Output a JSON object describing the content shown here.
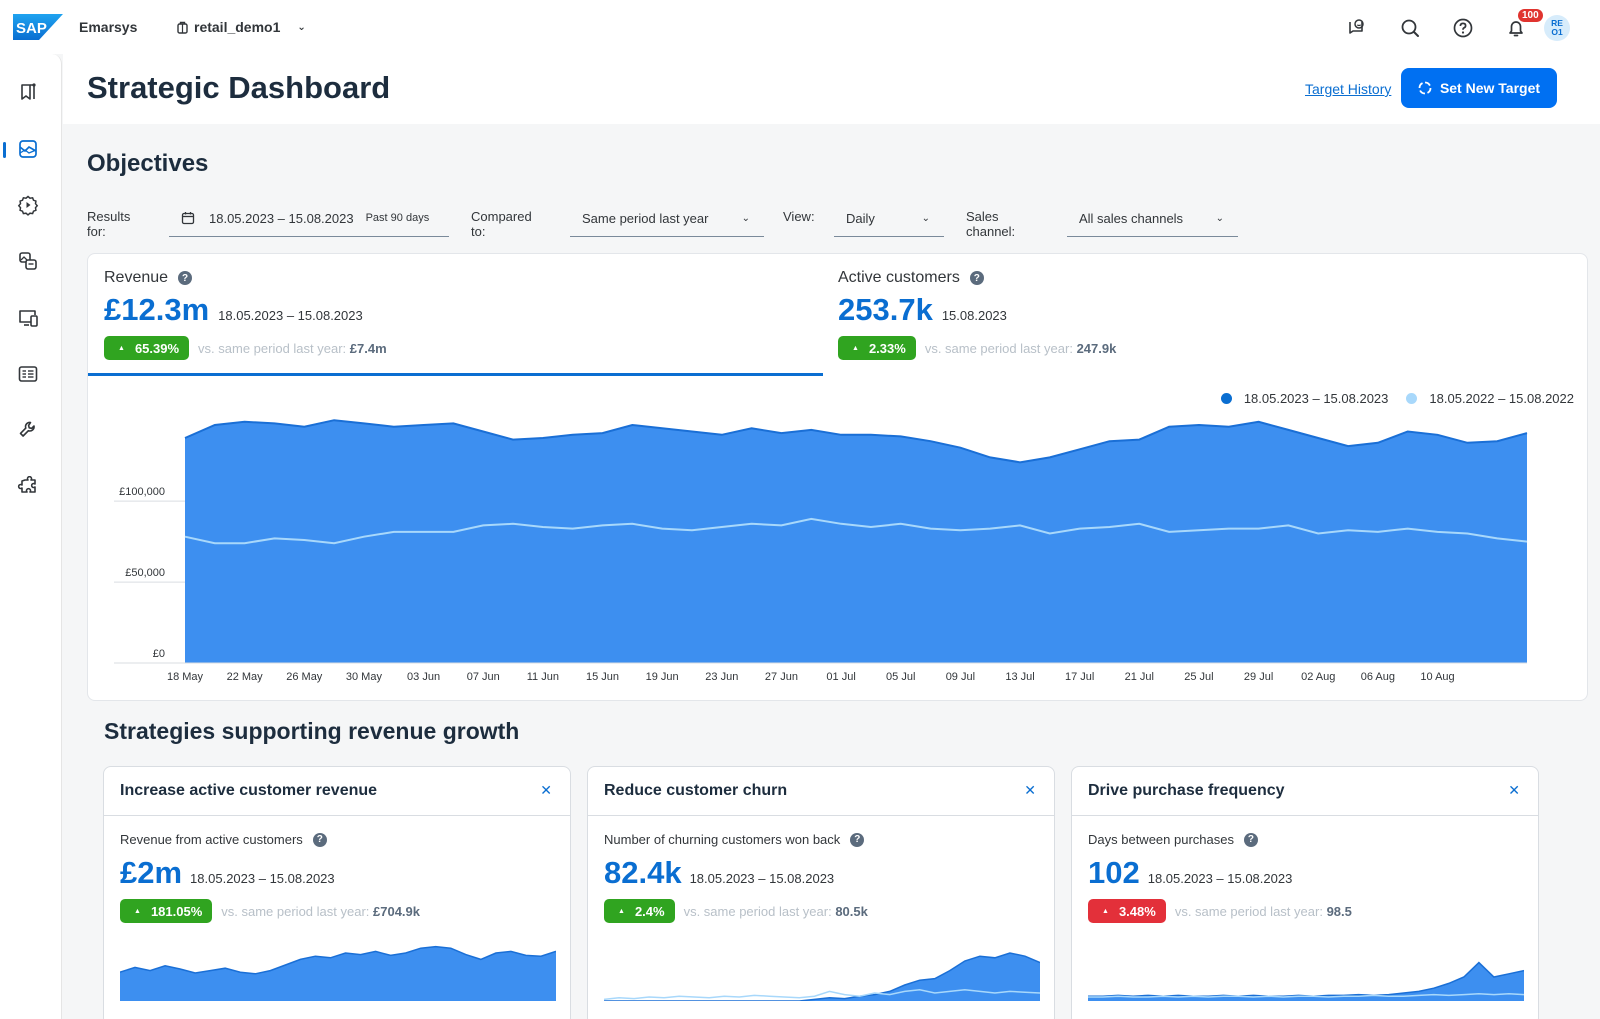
{
  "topbar": {
    "brand": "SAP",
    "product": "Emarsys",
    "account": "retail_demo1",
    "notifications_count": "100",
    "avatar_initials_line1": "RE",
    "avatar_initials_line2": "O1",
    "icons": [
      "feedback-icon",
      "search-icon",
      "help-icon",
      "bell-icon"
    ]
  },
  "leftnav": {
    "items": [
      {
        "icon": "bookmark-icon",
        "active": false
      },
      {
        "icon": "dashboard-chart-icon",
        "active": true
      },
      {
        "icon": "automation-gear-icon",
        "active": false
      },
      {
        "icon": "content-icon",
        "active": false
      },
      {
        "icon": "channels-devices-icon",
        "active": false
      },
      {
        "icon": "catalog-list-icon",
        "active": false
      },
      {
        "icon": "wrench-icon",
        "active": false
      },
      {
        "icon": "add-ons-puzzle-icon",
        "active": false
      }
    ]
  },
  "header": {
    "title": "Strategic Dashboard",
    "target_history_link": "Target History",
    "set_target_button": "Set New Target"
  },
  "objectives": {
    "title": "Objectives",
    "filters": {
      "results_for_label": "Results for:",
      "date_range": "18.05.2023 – 15.08.2023",
      "date_range_hint": "Past 90 days",
      "compared_to_label": "Compared to:",
      "compared_to_value": "Same period last year",
      "view_label": "View:",
      "view_value": "Daily",
      "sales_channel_label": "Sales channel:",
      "sales_channel_value": "All sales channels"
    },
    "kpis": [
      {
        "label": "Revenue",
        "value": "£12.3m",
        "date": "18.05.2023 – 15.08.2023",
        "delta": "65.39%",
        "delta_status": "good",
        "compare_label": "vs. same period last year:",
        "compare_value": "£7.4m",
        "active": true
      },
      {
        "label": "Active customers",
        "value": "253.7k",
        "date": "15.08.2023",
        "delta": "2.33%",
        "delta_status": "good",
        "compare_label": "vs. same period last year:",
        "compare_value": "247.9k",
        "active": false
      }
    ]
  },
  "colors": {
    "accent": "#0a6ed1",
    "button": "#0070f2",
    "current_series": "#3d8ff0",
    "current_series_line": "#1a6fd6",
    "previous_series": "#a8d8fb",
    "good": "#30a420",
    "bad": "#e3303a"
  },
  "chart_data": {
    "type": "area",
    "title": "Revenue",
    "xlabel": "",
    "ylabel": "",
    "ylim": [
      0,
      160000
    ],
    "grid": true,
    "legend_position": "top-right",
    "y_ticks": [
      {
        "value": 0,
        "label": "£0"
      },
      {
        "value": 50000,
        "label": "£50,000"
      },
      {
        "value": 100000,
        "label": "£100,000"
      }
    ],
    "x_tick_labels": [
      "18 May",
      "22 May",
      "26 May",
      "30 May",
      "03 Jun",
      "07 Jun",
      "11 Jun",
      "15 Jun",
      "19 Jun",
      "23 Jun",
      "27 Jun",
      "01 Jul",
      "05 Jul",
      "09 Jul",
      "13 Jul",
      "17 Jul",
      "21 Jul",
      "25 Jul",
      "29 Jul",
      "02 Aug",
      "06 Aug",
      "10 Aug"
    ],
    "x_day_step": 2,
    "total_days": 90,
    "series": [
      {
        "name": "18.05.2023 – 15.08.2023",
        "kind": "area",
        "values": [
          139000,
          147000,
          149000,
          148000,
          146000,
          150000,
          148000,
          146000,
          147000,
          148000,
          143000,
          138000,
          139000,
          141000,
          142000,
          147000,
          145000,
          143000,
          141000,
          145000,
          142000,
          144000,
          141000,
          141000,
          140000,
          137000,
          133000,
          127000,
          124000,
          127000,
          132000,
          137000,
          138000,
          146000,
          147000,
          146000,
          149000,
          144000,
          139000,
          134000,
          136000,
          143000,
          141000,
          136000,
          137000,
          142000
        ]
      },
      {
        "name": "18.05.2022 – 15.08.2022",
        "kind": "line",
        "values": [
          78000,
          74000,
          74000,
          77000,
          76000,
          74000,
          78000,
          81000,
          81000,
          81000,
          85000,
          86000,
          84000,
          83000,
          85000,
          86000,
          83000,
          82000,
          84000,
          86000,
          85000,
          89000,
          86000,
          84000,
          86000,
          83000,
          82000,
          83000,
          85000,
          80000,
          83000,
          84000,
          86000,
          81000,
          82000,
          83000,
          83000,
          85000,
          80000,
          82000,
          81000,
          83000,
          81000,
          80000,
          77000,
          75000
        ]
      }
    ]
  },
  "strategies": {
    "title": "Strategies supporting revenue growth",
    "cards": [
      {
        "title": "Increase active customer revenue",
        "metric_label": "Revenue from active customers",
        "value": "£2m",
        "date": "18.05.2023 – 15.08.2023",
        "delta": "181.05%",
        "delta_status": "good",
        "compare_label": "vs. same period last year:",
        "compare_value": "£704.9k",
        "spark_current": [
          36,
          42,
          38,
          44,
          40,
          35,
          38,
          41,
          36,
          34,
          38,
          45,
          52,
          56,
          54,
          60,
          58,
          62,
          57,
          60,
          66,
          68,
          66,
          58,
          52,
          60,
          62,
          57,
          56,
          62
        ],
        "spark_previous": []
      },
      {
        "title": "Reduce customer churn",
        "metric_label": "Number of churning customers won back",
        "value": "82.4k",
        "date": "18.05.2023 – 15.08.2023",
        "delta": "2.4%",
        "delta_status": "good",
        "compare_label": "vs. same period last year:",
        "compare_value": "80.5k",
        "spark_current": [
          0,
          0,
          0,
          0,
          0,
          0,
          0,
          0,
          0,
          0,
          0,
          0,
          0,
          0,
          2,
          4,
          3,
          6,
          8,
          12,
          20,
          26,
          28,
          38,
          50,
          56,
          54,
          60,
          56,
          48
        ],
        "spark_previous": [
          2,
          4,
          3,
          5,
          4,
          6,
          5,
          4,
          6,
          5,
          7,
          6,
          5,
          4,
          6,
          12,
          8,
          6,
          10,
          8,
          12,
          14,
          10,
          12,
          14,
          12,
          10,
          12,
          11,
          10
        ]
      },
      {
        "title": "Drive purchase frequency",
        "metric_label": "Days between purchases",
        "value": "102",
        "date": "18.05.2023 – 15.08.2023",
        "delta": "3.48%",
        "delta_status": "bad",
        "compare_label": "vs. same period last year:",
        "compare_value": "98.5",
        "spark_current": [
          6,
          6,
          7,
          6,
          7,
          6,
          7,
          6,
          6,
          7,
          6,
          7,
          6,
          6,
          7,
          6,
          7,
          7,
          8,
          7,
          8,
          10,
          12,
          16,
          22,
          30,
          48,
          30,
          34,
          38
        ],
        "spark_previous": [
          5,
          5,
          6,
          5,
          5,
          6,
          5,
          6,
          5,
          6,
          6,
          5,
          6,
          5,
          6,
          6,
          5,
          6,
          6,
          7,
          6,
          6,
          7,
          8,
          7,
          8,
          9,
          8,
          9,
          8
        ]
      }
    ]
  }
}
